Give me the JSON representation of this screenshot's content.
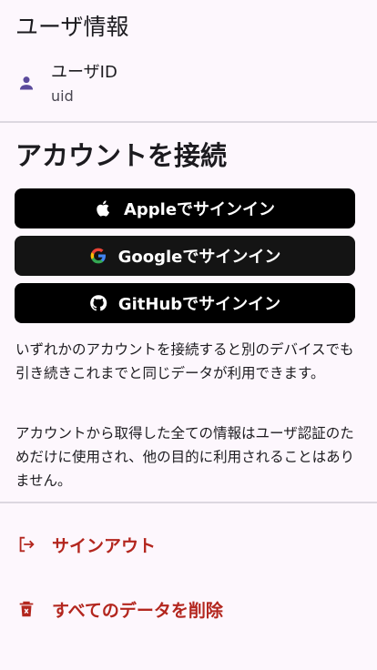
{
  "user_info": {
    "title": "ユーザ情報",
    "label": "ユーザID",
    "value": "uid"
  },
  "connect": {
    "title": "アカウントを接続",
    "apple_label": "Appleでサインイン",
    "google_label": "Googleでサインイン",
    "github_label": "GitHubでサインイン"
  },
  "notes": {
    "p1": "いずれかのアカウントを接続すると別のデバイスでも引き続きこれまでと同じデータが利用できます。",
    "p2": "アカウントから取得した全ての情報はユーザ認証のためだけに使用され、他の目的に利用されることはありません。"
  },
  "actions": {
    "signout_label": "サインアウト",
    "delete_label": "すべてのデータを削除"
  },
  "icons": {
    "user": "person-icon",
    "apple": "apple-icon",
    "google": "google-icon",
    "github": "github-icon",
    "signout": "logout-icon",
    "delete": "trash-icon"
  },
  "colors": {
    "background": "#fdf7fd",
    "accent_icon": "#5b4a9c",
    "danger": "#b3261e",
    "button": "#000000"
  }
}
